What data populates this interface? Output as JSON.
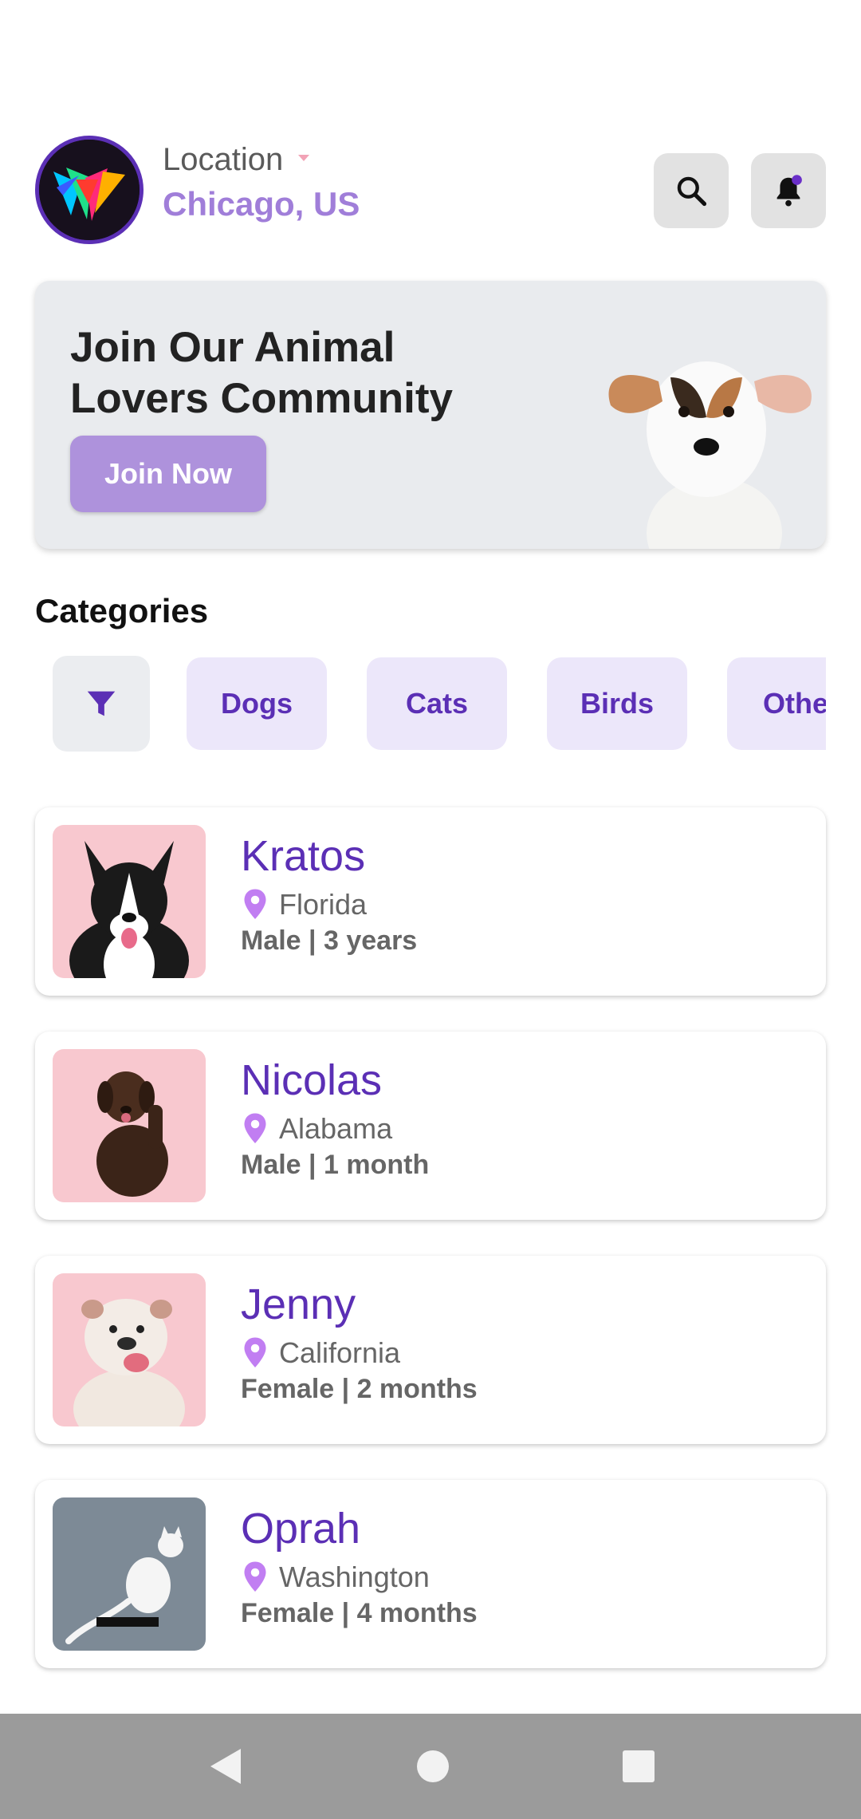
{
  "header": {
    "location_label": "Location",
    "location_value": "Chicago, US",
    "accent_color": "#a07ed9"
  },
  "banner": {
    "title": "Join Our Animal Lovers Community",
    "cta": "Join Now"
  },
  "categories": {
    "heading": "Categories",
    "items": [
      "Dogs",
      "Cats",
      "Birds",
      "Othe"
    ]
  },
  "pets": [
    {
      "name": "Kratos",
      "location": "Florida",
      "meta": "Male | 3 years",
      "photo": "dog-corgi-photo"
    },
    {
      "name": "Nicolas",
      "location": "Alabama",
      "meta": "Male | 1 month",
      "photo": "dog-labrador-puppy-photo"
    },
    {
      "name": "Jenny",
      "location": "California",
      "meta": "Female | 2 months",
      "photo": "dog-bulldog-photo"
    },
    {
      "name": "Oprah",
      "location": "Washington",
      "meta": "Female | 4 months",
      "photo": "cat-white-photo"
    }
  ],
  "icons": {
    "search": "search-icon",
    "notifications": "bell-icon",
    "filter": "filter-icon",
    "location_pin": "location-pin-icon",
    "nav_back": "back-triangle-icon",
    "nav_home": "home-circle-icon",
    "nav_recents": "recents-square-icon"
  }
}
